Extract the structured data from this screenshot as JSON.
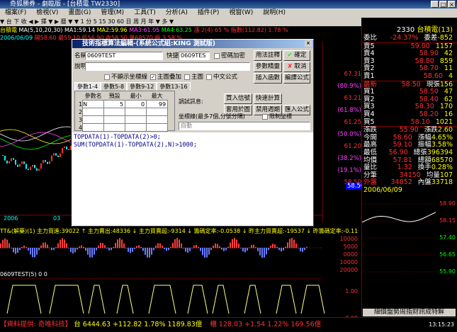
{
  "window": {
    "title": "奇狐勝券 - 劇臨版 - [台積電 TW2330]"
  },
  "menu": [
    "檔案(F)",
    "檢視(V)",
    "畫面(G)",
    "管理(M)",
    "工具(T)",
    "分析(A)",
    "插件(P)",
    "視窗(W)",
    "說明(H)"
  ],
  "toolbar": {
    "text": "▼ 台 下 收 ◀ ▶ 擇 ▼ ▶ 曆 ▼ ▼ 1 分 5 15 30 60 日 周 月 年 ▼ 多 ▼"
  },
  "info1": {
    "name": "台積電",
    "ma": "MA(5,10,20,30)",
    "ma1": "MA1:59.14",
    "ma2": "MA2:59.96",
    "ma3": "MA3:61.05",
    "ma4": "MA4:63.25",
    "extra": "漲 2(4) 65 % 指數(112.82) 1.78 %"
  },
  "info2": {
    "date": "2006/06/09",
    "vals": "開58.60 最59.10 低56.90 收58.50 量68570 振 3.58 %"
  },
  "right_panel": {
    "code": "2330",
    "name": "台積電(13)",
    "rows": [
      {
        "l": "委比",
        "v": "-24.37%",
        "l2": "委差",
        "v2": "-852"
      },
      {
        "l": "賣5",
        "v": "59.00",
        "v2": "1157"
      },
      {
        "l": "賣4",
        "v": "58.90",
        "v2": "42"
      },
      {
        "l": "賣3",
        "v": "58.80",
        "v2": "859"
      },
      {
        "l": "賣2",
        "v": "58.70",
        "v2": "11"
      },
      {
        "l": "賣1",
        "v": "58.60",
        "v2": "4"
      },
      {
        "l": "最新",
        "v": "58.50",
        "l2": "現張",
        "v2": "156"
      },
      {
        "l": "買1",
        "v": "58.50",
        "v2": "47"
      },
      {
        "l": "買2",
        "v": "58.40",
        "v2": "62"
      },
      {
        "l": "買3",
        "v": "58.30",
        "v2": "170"
      },
      {
        "l": "買4",
        "v": "58.20",
        "v2": "16"
      },
      {
        "l": "買5",
        "v": "58.10",
        "v2": "1021"
      },
      {
        "l": "漲跌",
        "v": "55.90",
        "l2": "漲跌",
        "v2": "2.60"
      },
      {
        "l": "今開",
        "v": "58.60",
        "l2": "漲幅",
        "v2": "4.65%"
      },
      {
        "l": "最高",
        "v": "59.10",
        "l2": "振幅",
        "v2": "3.58%"
      },
      {
        "l": "最低",
        "v": "56.90",
        "l2": "總張",
        "v2": "396394"
      },
      {
        "l": "均價",
        "v": "57.81",
        "l2": "總額",
        "v2": "68570"
      },
      {
        "l": "量比",
        "v": "1.32",
        "l2": "換手",
        "v2": "0.28%"
      },
      {
        "l": "分筆",
        "v": "34150",
        "l2": "均量",
        "v2": "107"
      },
      {
        "l": "外盤",
        "v": "34852",
        "l2": "內盤",
        "v2": "33718"
      }
    ],
    "mini_date": "2006/06/09",
    "mini_ticks": [
      "58.90",
      "58.15",
      "57.40",
      "56.65",
      "55.90"
    ],
    "tabs_text": "細價盤勢周指財訊成特解"
  },
  "main_chart": {
    "y_labels": [
      "67.31",
      "(80.9%)",
      "63.21",
      "(61.8%)",
      "61.25",
      "(50.0%)",
      "61.20",
      "(38.2%)",
      "(19.1%)",
      "58.50"
    ],
    "x_labels": [
      "2006",
      "03",
      "02",
      "03"
    ],
    "price_tag": "58.50"
  },
  "indicator": {
    "label": "TT&(解藥)(1) 主力買進:39022 ↑ 主力賣出:48336 ↓ 主力買賣超:-9314 ↓ 籌碼定率:-0.0538 ↓ 昨主力買賣超:-19537 ↓ 昨籌碼定率:-0.1129 ↓",
    "ticks": [
      "10000",
      "5000",
      "0000",
      "10000",
      "20000"
    ]
  },
  "test_ind": {
    "label": "0609TEST(5) 0 0",
    "ticks": [
      "1.00",
      "0.00"
    ]
  },
  "dialog": {
    "title": "技術指標算法編輯-(系統公式組:KING 測試版)",
    "name_label": "名稱",
    "name_value": "0609TEST",
    "shortcut_label": "快捷碼",
    "shortcut_value": "0609TES",
    "password_label": "密碼加密",
    "desc_label": "說明",
    "opt1": "不顯示坐標線",
    "opt2": "主圖疊加",
    "opt3": "主圖",
    "opt4": "中文公式",
    "tabs": [
      "參數1-4",
      "參數5-8",
      "參數9-12",
      "參數13-16"
    ],
    "grid_headers": [
      "參數名",
      "預設",
      "最小",
      "最大"
    ],
    "grid_row1": {
      "n": "N",
      "def": "5",
      "min": "0",
      "max": "99"
    },
    "grid_rows": [
      "1",
      "2",
      "3",
      "4"
    ],
    "btn_usage": "用法註釋",
    "btn_ok": "確定",
    "btn_params": "參數精靈",
    "btn_cancel": "取消",
    "btn_insert_fn": "插入函數",
    "btn_edit_fn": "編譯公式",
    "btn_buy_sell": "買入信號",
    "btn_quick": "快速計算",
    "btn_used": "套用於圖",
    "btn_disable": "禁用週期",
    "btn_import": "匯入公式",
    "debug_label": "調試訊息:",
    "coords_label": "坐標線(最多7個,分號分隔)",
    "limit_label": "限制坐標",
    "auto_value": "自動",
    "code_lines": [
      "TOPDATA(1)-TOPDATA(2)>0;",
      "SUM(TOPDATA(1)-TOPDATA(2),N)>1000;"
    ]
  },
  "status": {
    "label": "【資料提供: 奇唯科技】",
    "tw": "台 6444.63 +112.82 1.78% 1189.83億",
    "otc": "櫃 128.03 +1.54 1.22% 169.56億",
    "time": "13:15:23"
  }
}
